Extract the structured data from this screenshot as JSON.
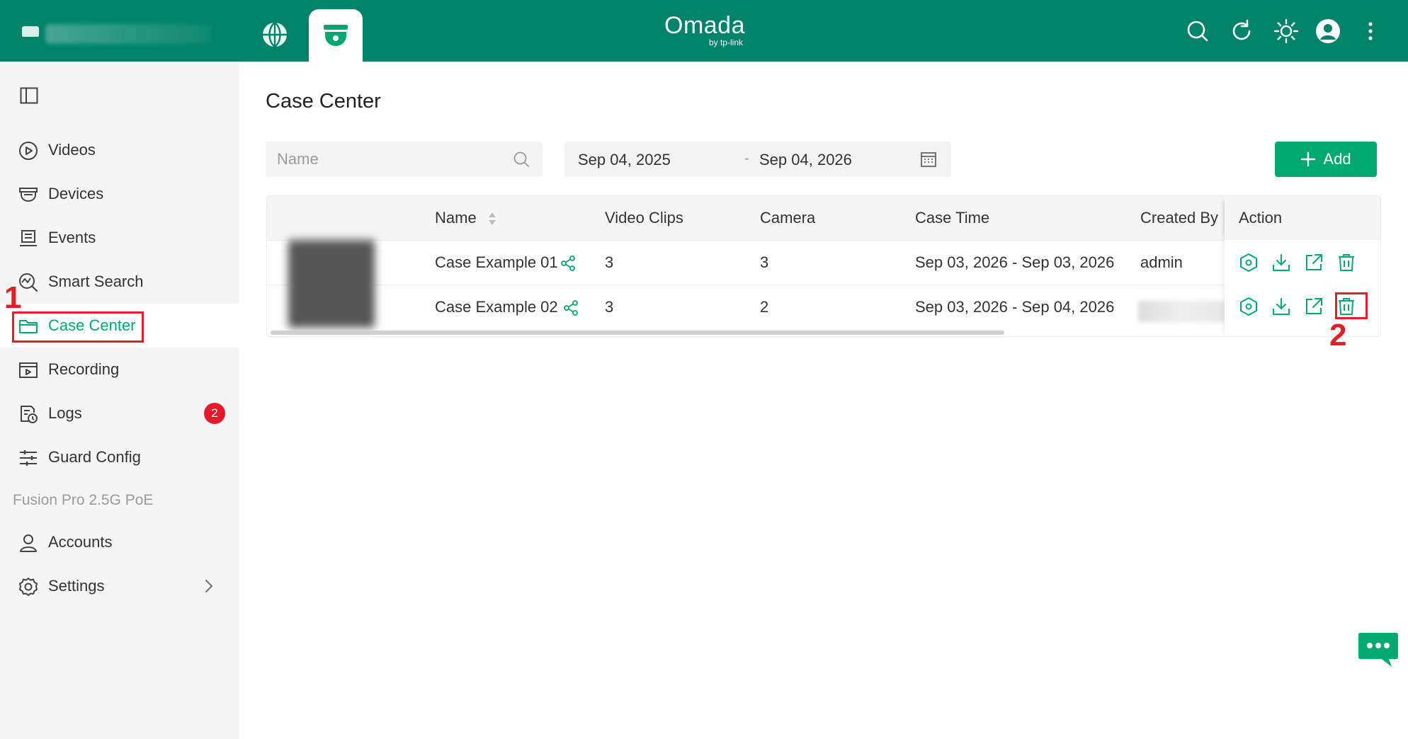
{
  "header": {
    "logo_text": "Omada",
    "logo_sub": "by tp-link",
    "site_icon": "site-icon",
    "icons": [
      "globe-icon",
      "camera-dome-icon",
      "search-icon",
      "refresh-icon",
      "brightness-icon",
      "user-avatar-icon",
      "more-vertical-icon"
    ]
  },
  "sidebar": {
    "items": [
      {
        "label": "Videos",
        "icon": "play-circle-icon"
      },
      {
        "label": "Devices",
        "icon": "camera-icon"
      },
      {
        "label": "Events",
        "icon": "events-icon"
      },
      {
        "label": "Smart Search",
        "icon": "smart-search-icon"
      },
      {
        "label": "Case Center",
        "icon": "folder-icon",
        "active": true
      },
      {
        "label": "Recording",
        "icon": "recording-icon"
      },
      {
        "label": "Logs",
        "icon": "logs-icon",
        "badge": "2"
      },
      {
        "label": "Guard Config",
        "icon": "sliders-icon"
      }
    ],
    "section_label": "Fusion Pro 2.5G PoE",
    "bottom_items": [
      {
        "label": "Accounts",
        "icon": "user-icon"
      },
      {
        "label": "Settings",
        "icon": "gear-icon"
      }
    ]
  },
  "annotations": {
    "step1": "1",
    "step2": "2"
  },
  "main": {
    "title": "Case Center",
    "search": {
      "placeholder": "Name",
      "value": ""
    },
    "date_range": {
      "start": "Sep 04, 2025",
      "separator": "-",
      "end": "Sep 04, 2026"
    },
    "add_label": "Add",
    "table": {
      "columns": [
        "Name",
        "Video Clips",
        "Camera",
        "Case Time",
        "Created By",
        "Action"
      ],
      "rows": [
        {
          "name": "Case Example 01",
          "video_clips": "3",
          "camera": "3",
          "case_time": "Sep 03, 2026 - Sep 03, 2026",
          "created_by": "admin"
        },
        {
          "name": "Case Example 02",
          "video_clips": "3",
          "camera": "2",
          "case_time": "Sep 03, 2026 - Sep 04, 2026",
          "created_by": ""
        }
      ],
      "action_icons": [
        "view-icon",
        "download-icon",
        "share-link-icon",
        "delete-icon"
      ]
    }
  },
  "colors": {
    "brand": "#00836a",
    "accent": "#00a870",
    "annotation": "#e21f25",
    "badge": "#e8192c"
  }
}
